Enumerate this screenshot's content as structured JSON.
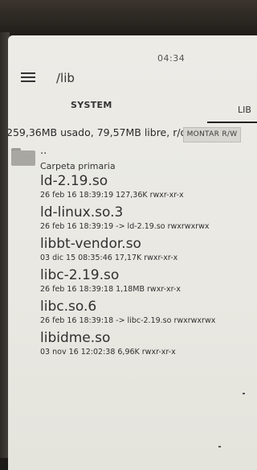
{
  "status": {
    "time": "04:34"
  },
  "header": {
    "path": "/lib"
  },
  "tabs": [
    {
      "label": "SYSTEM"
    },
    {
      "label": "LIB"
    }
  ],
  "storage": {
    "info": "259,36MB usado, 79,57MB libre, r/o",
    "mount_label": "MONTAR R/W"
  },
  "parent": {
    "dots": "..",
    "label": "Carpeta primaria"
  },
  "files": [
    {
      "name": "ld-2.19.so",
      "meta": "26 feb 16 18:39:19 127,36K rwxr-xr-x"
    },
    {
      "name": "ld-linux.so.3",
      "meta": "26 feb 16 18:39:19 -> ld-2.19.so rwxrwxrwx"
    },
    {
      "name": "libbt-vendor.so",
      "meta": "03 dic 15 08:35:46 17,17K rwxr-xr-x"
    },
    {
      "name": "libc-2.19.so",
      "meta": "26 feb 16 18:39:18 1,18MB rwxr-xr-x"
    },
    {
      "name": "libc.so.6",
      "meta": "26 feb 16 18:39:18 -> libc-2.19.so rwxrwxrwx"
    },
    {
      "name": "libidme.so",
      "meta": "03 nov 16 12:02:38 6,96K rwxr-xr-x"
    }
  ]
}
